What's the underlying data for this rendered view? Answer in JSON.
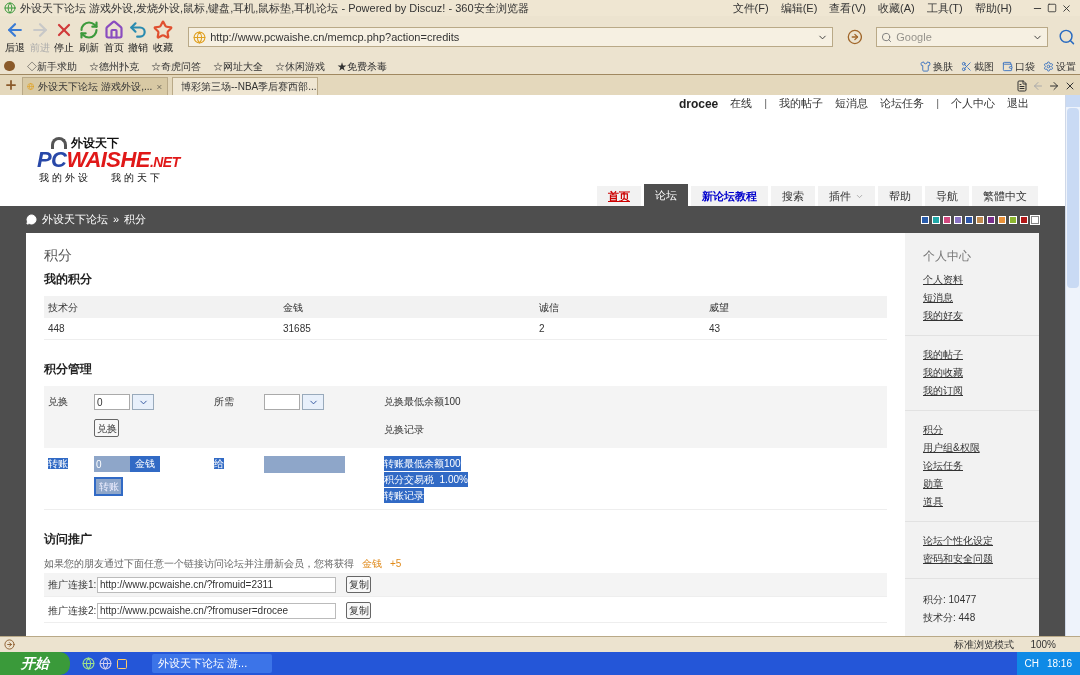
{
  "window": {
    "title": "外设天下论坛 游戏外设,发烧外设,鼠标,键盘,耳机,鼠标垫,耳机论坛 - Powered by Discuz! - 360安全浏览器"
  },
  "menu": [
    "文件(F)",
    "编辑(E)",
    "查看(V)",
    "收藏(A)",
    "工具(T)",
    "帮助(H)"
  ],
  "toolbar": [
    {
      "label": "后退",
      "kind": "back",
      "disabled": false
    },
    {
      "label": "前进",
      "kind": "forward",
      "disabled": true
    },
    {
      "label": "停止",
      "kind": "stop",
      "disabled": false
    },
    {
      "label": "刷新",
      "kind": "refresh",
      "disabled": false
    },
    {
      "label": "首页",
      "kind": "home",
      "disabled": false
    },
    {
      "label": "撤销",
      "kind": "undo",
      "disabled": false
    },
    {
      "label": "收藏",
      "kind": "star",
      "disabled": false
    }
  ],
  "address": {
    "value": "http://www.pcwaishe.cn/memcp.php?action=credits"
  },
  "search": {
    "placeholder": "Google"
  },
  "bookmarks": [
    "◇新手求助",
    "☆德州扑克",
    "☆奇虎问答",
    "☆网址大全",
    "☆休闲游戏",
    "★免费杀毒"
  ],
  "bookmark_tools": [
    "换肤",
    "截图",
    "口袋",
    "设置"
  ],
  "browser_tabs": [
    {
      "label": "外设天下论坛 游戏外设,...",
      "selected": true
    },
    {
      "label": "博彩第三场--NBA季后赛西部...",
      "selected": false
    }
  ],
  "user_links": [
    {
      "text": "drocee",
      "kind": "user"
    },
    {
      "text": "在线",
      "kind": "status"
    },
    {
      "text": "|",
      "kind": "sep"
    },
    {
      "text": "我的帖子",
      "kind": "link"
    },
    {
      "text": "短消息",
      "kind": "link"
    },
    {
      "text": "论坛任务",
      "kind": "link"
    },
    {
      "text": "|",
      "kind": "sep"
    },
    {
      "text": "个人中心",
      "kind": "link"
    },
    {
      "text": "退出",
      "kind": "link"
    }
  ],
  "logo": {
    "title": "外设天下",
    "brand_a": "PC",
    "brand_b": "WAISHE",
    "brand_c": ".NET",
    "slogan_a": "我的外设",
    "slogan_b": "我的天下"
  },
  "nav": [
    {
      "label": "首页",
      "selected": false,
      "kind": "home",
      "dropdown": false
    },
    {
      "label": "论坛",
      "selected": true,
      "kind": "normal",
      "dropdown": false
    },
    {
      "label": "新论坛教程",
      "selected": false,
      "kind": "featured",
      "dropdown": false
    },
    {
      "label": "搜索",
      "selected": false,
      "kind": "normal",
      "dropdown": false
    },
    {
      "label": "插件",
      "selected": false,
      "kind": "normal",
      "dropdown": true
    },
    {
      "label": "帮助",
      "selected": false,
      "kind": "normal",
      "dropdown": false
    },
    {
      "label": "导航",
      "selected": false,
      "kind": "normal",
      "dropdown": false
    },
    {
      "label": "繁體中文",
      "selected": false,
      "kind": "normal",
      "dropdown": false
    }
  ],
  "breadcrumb": [
    "外设天下论坛",
    "»",
    "积分"
  ],
  "skins": [
    {
      "color": "#2a5caa",
      "selected": false
    },
    {
      "color": "#22a8a8",
      "selected": false
    },
    {
      "color": "#d2487e",
      "selected": false
    },
    {
      "color": "#8a73c4",
      "selected": false
    },
    {
      "color": "#2e56a8",
      "selected": false
    },
    {
      "color": "#c08a50",
      "selected": false
    },
    {
      "color": "#7a2f8c",
      "selected": false
    },
    {
      "color": "#e8913a",
      "selected": false
    },
    {
      "color": "#8cb530",
      "selected": false
    },
    {
      "color": "#b01818",
      "selected": false
    },
    {
      "color": "#ffffff",
      "selected": true
    }
  ],
  "page_title": "积分",
  "my_credits": {
    "heading": "我的积分",
    "columns": [
      "技术分",
      "金钱",
      "诚信",
      "威望"
    ],
    "values": [
      "448",
      "31685",
      "2",
      "43"
    ]
  },
  "management": {
    "heading": "积分管理",
    "exchange": {
      "label": "兑换",
      "amount": "0",
      "need_label": "所需",
      "button": "兑换",
      "note": "兑换最低余额100",
      "record": "兑换记录",
      "text_selected": false
    },
    "transfer": {
      "label": "转账",
      "amount": "0",
      "unit": "金钱",
      "to_label": "给",
      "button": "转账",
      "notes": [
        "转账最低余额100",
        "积分交易税  1.00%"
      ],
      "record": "转账记录",
      "text_selected": true
    }
  },
  "promotion": {
    "heading": "访问推广",
    "text": "如果您的朋友通过下面任意一个链接访问论坛并注册新会员，您将获得",
    "reward_a": "金钱",
    "reward_b": "+5",
    "links": [
      {
        "label": "推广连接1:",
        "url": "http://www.pcwaishe.cn/?fromuid=2311",
        "button": "复制"
      },
      {
        "label": "推广连接2:",
        "url": "http://www.pcwaishe.cn/?fromuser=drocee",
        "button": "复制"
      }
    ]
  },
  "sidebar": {
    "heading": "个人中心",
    "groups": [
      [
        "个人资料",
        "短消息",
        "我的好友"
      ],
      [
        "我的帖子",
        "我的收藏",
        "我的订阅"
      ],
      [
        "积分",
        "用户组&权限",
        "论坛任务",
        "勋章",
        "道具"
      ],
      [
        "论坛个性化设定",
        "密码和安全问题"
      ]
    ],
    "stats": [
      "积分: 10477",
      "技术分: 448"
    ]
  },
  "status_bar": {
    "mode": "标准浏览模式",
    "zoom": "100%"
  },
  "taskbar": {
    "start": "开始",
    "task": "外设天下论坛 游...",
    "lang": "CH",
    "clock": "18:16"
  }
}
